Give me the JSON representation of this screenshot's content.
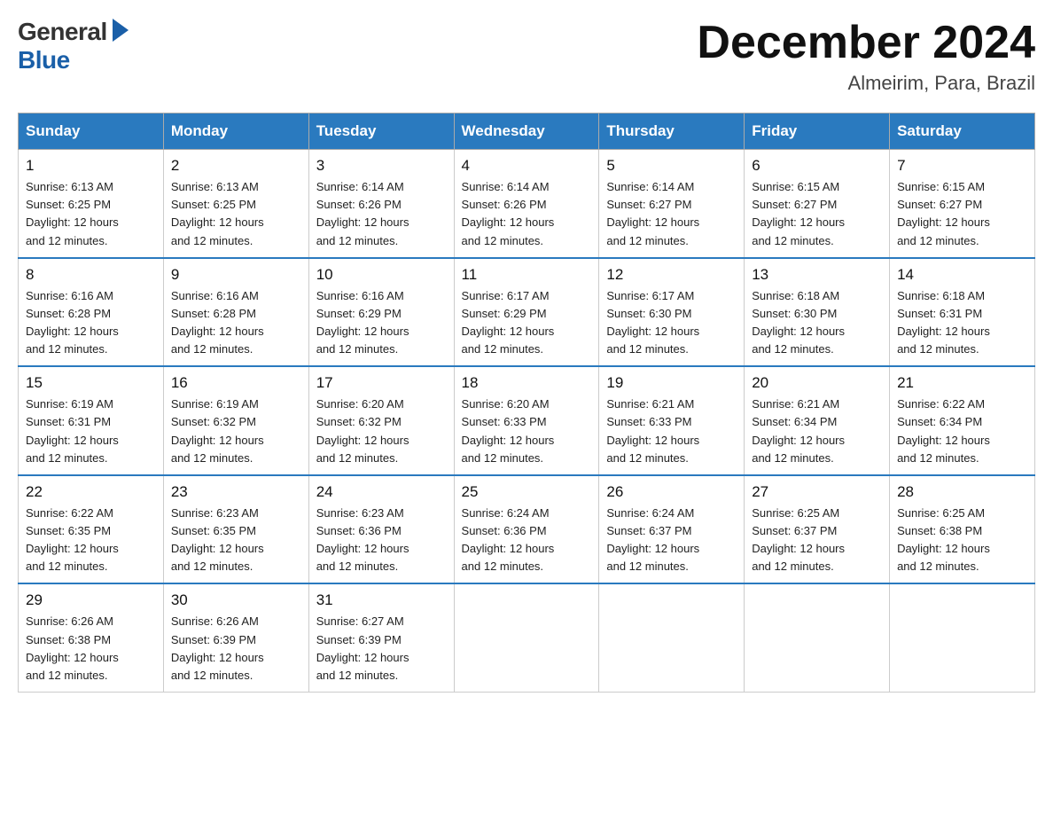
{
  "logo": {
    "general": "General",
    "blue": "Blue"
  },
  "title": "December 2024",
  "location": "Almeirim, Para, Brazil",
  "days_header": [
    "Sunday",
    "Monday",
    "Tuesday",
    "Wednesday",
    "Thursday",
    "Friday",
    "Saturday"
  ],
  "weeks": [
    [
      {
        "day": "1",
        "sunrise": "6:13 AM",
        "sunset": "6:25 PM",
        "daylight": "12 hours and 12 minutes."
      },
      {
        "day": "2",
        "sunrise": "6:13 AM",
        "sunset": "6:25 PM",
        "daylight": "12 hours and 12 minutes."
      },
      {
        "day": "3",
        "sunrise": "6:14 AM",
        "sunset": "6:26 PM",
        "daylight": "12 hours and 12 minutes."
      },
      {
        "day": "4",
        "sunrise": "6:14 AM",
        "sunset": "6:26 PM",
        "daylight": "12 hours and 12 minutes."
      },
      {
        "day": "5",
        "sunrise": "6:14 AM",
        "sunset": "6:27 PM",
        "daylight": "12 hours and 12 minutes."
      },
      {
        "day": "6",
        "sunrise": "6:15 AM",
        "sunset": "6:27 PM",
        "daylight": "12 hours and 12 minutes."
      },
      {
        "day": "7",
        "sunrise": "6:15 AM",
        "sunset": "6:27 PM",
        "daylight": "12 hours and 12 minutes."
      }
    ],
    [
      {
        "day": "8",
        "sunrise": "6:16 AM",
        "sunset": "6:28 PM",
        "daylight": "12 hours and 12 minutes."
      },
      {
        "day": "9",
        "sunrise": "6:16 AM",
        "sunset": "6:28 PM",
        "daylight": "12 hours and 12 minutes."
      },
      {
        "day": "10",
        "sunrise": "6:16 AM",
        "sunset": "6:29 PM",
        "daylight": "12 hours and 12 minutes."
      },
      {
        "day": "11",
        "sunrise": "6:17 AM",
        "sunset": "6:29 PM",
        "daylight": "12 hours and 12 minutes."
      },
      {
        "day": "12",
        "sunrise": "6:17 AM",
        "sunset": "6:30 PM",
        "daylight": "12 hours and 12 minutes."
      },
      {
        "day": "13",
        "sunrise": "6:18 AM",
        "sunset": "6:30 PM",
        "daylight": "12 hours and 12 minutes."
      },
      {
        "day": "14",
        "sunrise": "6:18 AM",
        "sunset": "6:31 PM",
        "daylight": "12 hours and 12 minutes."
      }
    ],
    [
      {
        "day": "15",
        "sunrise": "6:19 AM",
        "sunset": "6:31 PM",
        "daylight": "12 hours and 12 minutes."
      },
      {
        "day": "16",
        "sunrise": "6:19 AM",
        "sunset": "6:32 PM",
        "daylight": "12 hours and 12 minutes."
      },
      {
        "day": "17",
        "sunrise": "6:20 AM",
        "sunset": "6:32 PM",
        "daylight": "12 hours and 12 minutes."
      },
      {
        "day": "18",
        "sunrise": "6:20 AM",
        "sunset": "6:33 PM",
        "daylight": "12 hours and 12 minutes."
      },
      {
        "day": "19",
        "sunrise": "6:21 AM",
        "sunset": "6:33 PM",
        "daylight": "12 hours and 12 minutes."
      },
      {
        "day": "20",
        "sunrise": "6:21 AM",
        "sunset": "6:34 PM",
        "daylight": "12 hours and 12 minutes."
      },
      {
        "day": "21",
        "sunrise": "6:22 AM",
        "sunset": "6:34 PM",
        "daylight": "12 hours and 12 minutes."
      }
    ],
    [
      {
        "day": "22",
        "sunrise": "6:22 AM",
        "sunset": "6:35 PM",
        "daylight": "12 hours and 12 minutes."
      },
      {
        "day": "23",
        "sunrise": "6:23 AM",
        "sunset": "6:35 PM",
        "daylight": "12 hours and 12 minutes."
      },
      {
        "day": "24",
        "sunrise": "6:23 AM",
        "sunset": "6:36 PM",
        "daylight": "12 hours and 12 minutes."
      },
      {
        "day": "25",
        "sunrise": "6:24 AM",
        "sunset": "6:36 PM",
        "daylight": "12 hours and 12 minutes."
      },
      {
        "day": "26",
        "sunrise": "6:24 AM",
        "sunset": "6:37 PM",
        "daylight": "12 hours and 12 minutes."
      },
      {
        "day": "27",
        "sunrise": "6:25 AM",
        "sunset": "6:37 PM",
        "daylight": "12 hours and 12 minutes."
      },
      {
        "day": "28",
        "sunrise": "6:25 AM",
        "sunset": "6:38 PM",
        "daylight": "12 hours and 12 minutes."
      }
    ],
    [
      {
        "day": "29",
        "sunrise": "6:26 AM",
        "sunset": "6:38 PM",
        "daylight": "12 hours and 12 minutes."
      },
      {
        "day": "30",
        "sunrise": "6:26 AM",
        "sunset": "6:39 PM",
        "daylight": "12 hours and 12 minutes."
      },
      {
        "day": "31",
        "sunrise": "6:27 AM",
        "sunset": "6:39 PM",
        "daylight": "12 hours and 12 minutes."
      },
      null,
      null,
      null,
      null
    ]
  ]
}
